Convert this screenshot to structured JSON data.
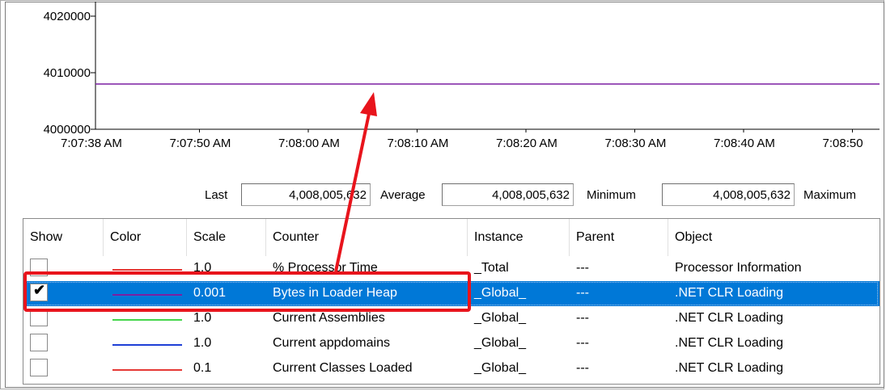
{
  "chart_data": {
    "type": "line",
    "y_ticks": [
      "4020000",
      "4010000",
      "4000000"
    ],
    "ylim": [
      4000000,
      4020000
    ],
    "x_ticks": [
      "7:07:38 AM",
      "7:07:50 AM",
      "7:08:00 AM",
      "7:08:10 AM",
      "7:08:20 AM",
      "7:08:30 AM",
      "7:08:40 AM",
      "7:08:50"
    ],
    "series": [
      {
        "color": "#7b1fa2",
        "values": [
          4008006,
          4008006
        ]
      }
    ]
  },
  "stats": {
    "last_label": "Last",
    "last_value": "4,008,005,632",
    "average_label": "Average",
    "average_value": "4,008,005,632",
    "minimum_label": "Minimum",
    "minimum_value": "4,008,005,632",
    "maximum_label": "Maximum"
  },
  "table": {
    "headers": [
      "Show",
      "Color",
      "Scale",
      "Counter",
      "Instance",
      "Parent",
      "Object"
    ],
    "rows": [
      {
        "show": false,
        "color": "#e53935",
        "scale": "1.0",
        "counter": "% Processor Time",
        "instance": "_Total",
        "parent": "---",
        "object": "Processor Information"
      },
      {
        "show": true,
        "color": "#7b1fa2",
        "scale": "0.001",
        "counter": "Bytes in Loader Heap",
        "instance": "_Global_",
        "parent": "---",
        "object": ".NET CLR Loading",
        "selected": true
      },
      {
        "show": false,
        "color": "#43d64b",
        "scale": "1.0",
        "counter": "Current Assemblies",
        "instance": "_Global_",
        "parent": "---",
        "object": ".NET CLR Loading"
      },
      {
        "show": false,
        "color": "#1e3fd6",
        "scale": "1.0",
        "counter": "Current appdomains",
        "instance": "_Global_",
        "parent": "---",
        "object": ".NET CLR Loading"
      },
      {
        "show": false,
        "color": "#e53935",
        "scale": "0.1",
        "counter": "Current Classes Loaded",
        "instance": "_Global_",
        "parent": "---",
        "object": ".NET CLR Loading"
      }
    ]
  },
  "colors": {
    "selection": "#0078d7",
    "annotation": "#e8141c"
  }
}
